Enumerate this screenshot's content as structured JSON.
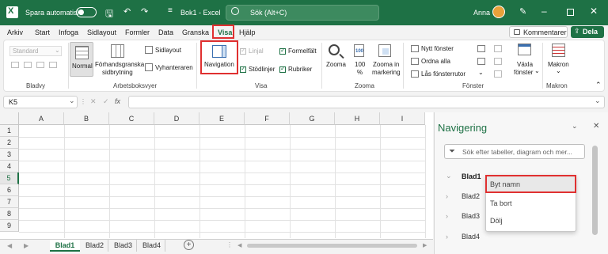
{
  "title_bar": {
    "autosave_label": "Spara automatiskt",
    "doc_title": "Bok1 - Excel",
    "search_placeholder": "Sök (Alt+C)",
    "user_name": "Anna"
  },
  "menu": {
    "items": [
      "Arkiv",
      "Start",
      "Infoga",
      "Sidlayout",
      "Formler",
      "Data",
      "Granska",
      "Visa",
      "Hjälp"
    ],
    "active": "Visa",
    "comments_label": "Kommentarer",
    "share_label": "Dela"
  },
  "ribbon": {
    "sheet_view_dropdown": "Standard",
    "groups": {
      "bladvy": "Bladvy",
      "arbetsboksvyer": "Arbetsboksvyer",
      "visa": "Visa",
      "zooma": "Zooma",
      "fonster": "Fönster",
      "makron": "Makron"
    },
    "normal": "Normal",
    "page_break_1": "Förhandsgranska",
    "page_break_2": "sidbrytning",
    "page_layout": "Sidlayout",
    "custom_views": "Vyhanteraren",
    "navigation": "Navigation",
    "ruler": "Linjal",
    "gridlines": "Stödlinjer",
    "formula_bar": "Formelfält",
    "headings": "Rubriker",
    "zoom": "Zooma",
    "zoom100_1": "100",
    "zoom100_2": "%",
    "zoom_sel_1": "Zooma in",
    "zoom_sel_2": "markering",
    "new_window": "Nytt fönster",
    "arrange_all": "Ordna alla",
    "freeze_panes": "Lås fönsterrutor",
    "switch_windows_1": "Växla",
    "switch_windows_2": "fönster",
    "macros": "Makron"
  },
  "formula_bar": {
    "name_box": "K5",
    "fx": "fx",
    "value": ""
  },
  "grid": {
    "columns": [
      "A",
      "B",
      "C",
      "D",
      "E",
      "F",
      "G",
      "H",
      "I"
    ],
    "rows": [
      "1",
      "2",
      "3",
      "4",
      "5",
      "6",
      "7",
      "8",
      "9"
    ],
    "selected_row": "5"
  },
  "sheets": {
    "tabs": [
      "Blad1",
      "Blad2",
      "Blad3",
      "Blad4"
    ],
    "active": "Blad1"
  },
  "nav_pane": {
    "title": "Navigering",
    "search_placeholder": "Sök efter tabeller, diagram och mer...",
    "items": [
      "Blad1",
      "Blad2",
      "Blad3",
      "Blad4"
    ]
  },
  "context_menu": {
    "items": [
      "Byt namn",
      "Ta bort",
      "Dölj"
    ]
  },
  "colors": {
    "brand": "#1e7145",
    "highlight": "#e03030"
  }
}
